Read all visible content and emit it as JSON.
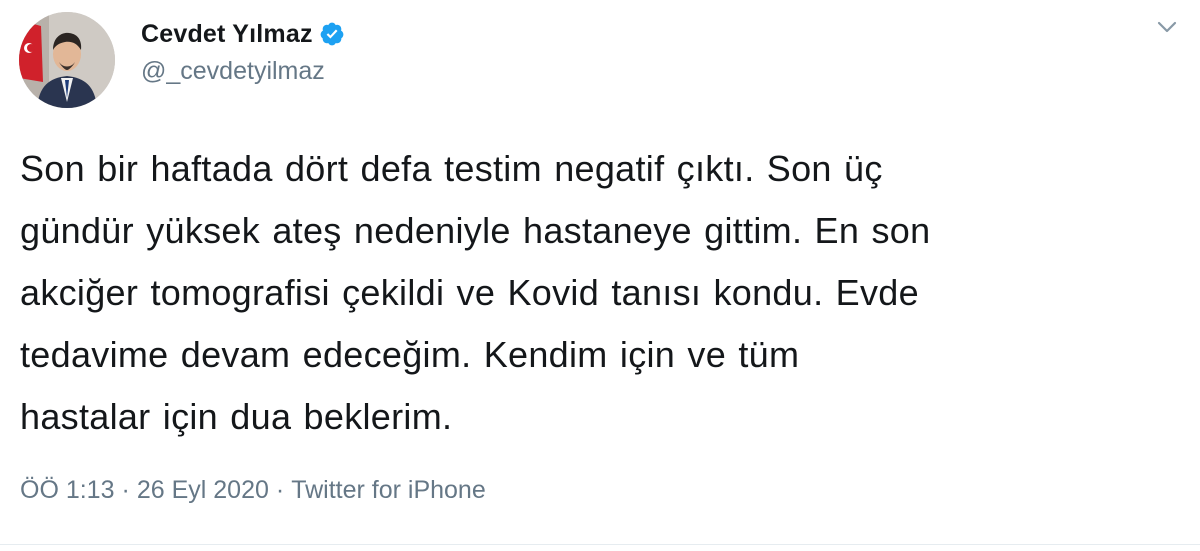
{
  "author": {
    "display_name": "Cevdet Yılmaz",
    "handle": "@_cevdetyilmaz",
    "verified": true,
    "avatar_icon": "profile-photo"
  },
  "tweet": {
    "lines": [
      "Son bir haftada dört defa testim negatif çıktı. Son üç",
      "gündür yüksek ateş nedeniyle hastaneye gittim. En son",
      "akciğer tomografisi çekildi ve Kovid tanısı kondu. Evde",
      "tedavime devam edeceğim. Kendim için ve tüm",
      "hastalar için dua beklerim."
    ]
  },
  "meta": {
    "time": "ÖÖ 1:13",
    "separator": "·",
    "date": "26 Eyl 2020",
    "source": "Twitter for iPhone"
  },
  "icons": {
    "verified": "verified-badge-icon",
    "more": "chevron-down-icon"
  },
  "colors": {
    "text": "#14171a",
    "secondary": "#657786",
    "verified": "#1da1f2",
    "divider": "#e6ecf0"
  }
}
